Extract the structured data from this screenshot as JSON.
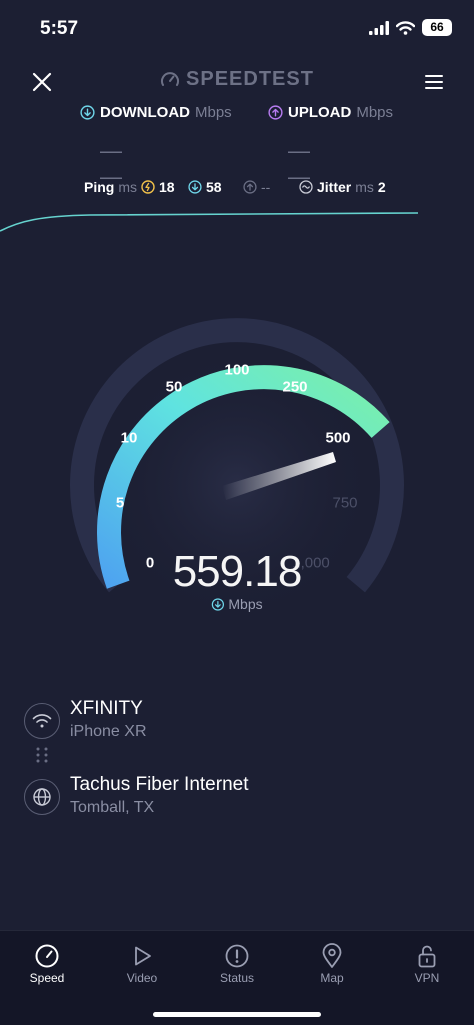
{
  "status_bar": {
    "time": "5:57",
    "battery": "66"
  },
  "header": {
    "brand": "SPEEDTEST"
  },
  "download": {
    "label": "DOWNLOAD",
    "unit": "Mbps",
    "value": "— —"
  },
  "upload": {
    "label": "UPLOAD",
    "unit": "Mbps",
    "value": "— —"
  },
  "ping": {
    "label": "Ping",
    "unit": "ms",
    "idle": "18",
    "download": "58",
    "upload": "--",
    "jitter_label": "Jitter",
    "jitter_unit": "ms",
    "jitter": "2"
  },
  "gauge": {
    "labels": [
      "0",
      "5",
      "10",
      "50",
      "100",
      "250",
      "500",
      "750",
      "1,000"
    ],
    "value": "559.18",
    "unit": "Mbps",
    "colors": {
      "start": "#4ea3f0",
      "mid": "#5fe3e0",
      "end": "#7cf0a8",
      "track": "#2a2f4a"
    }
  },
  "connection": {
    "provider": "XFINITY",
    "device": "iPhone XR",
    "server": "Tachus Fiber Internet",
    "location": "Tomball, TX"
  },
  "tabs": [
    {
      "label": "Speed",
      "icon": "speedometer-icon"
    },
    {
      "label": "Video",
      "icon": "play-icon"
    },
    {
      "label": "Status",
      "icon": "alert-icon"
    },
    {
      "label": "Map",
      "icon": "map-pin-icon"
    },
    {
      "label": "VPN",
      "icon": "lock-icon"
    }
  ]
}
